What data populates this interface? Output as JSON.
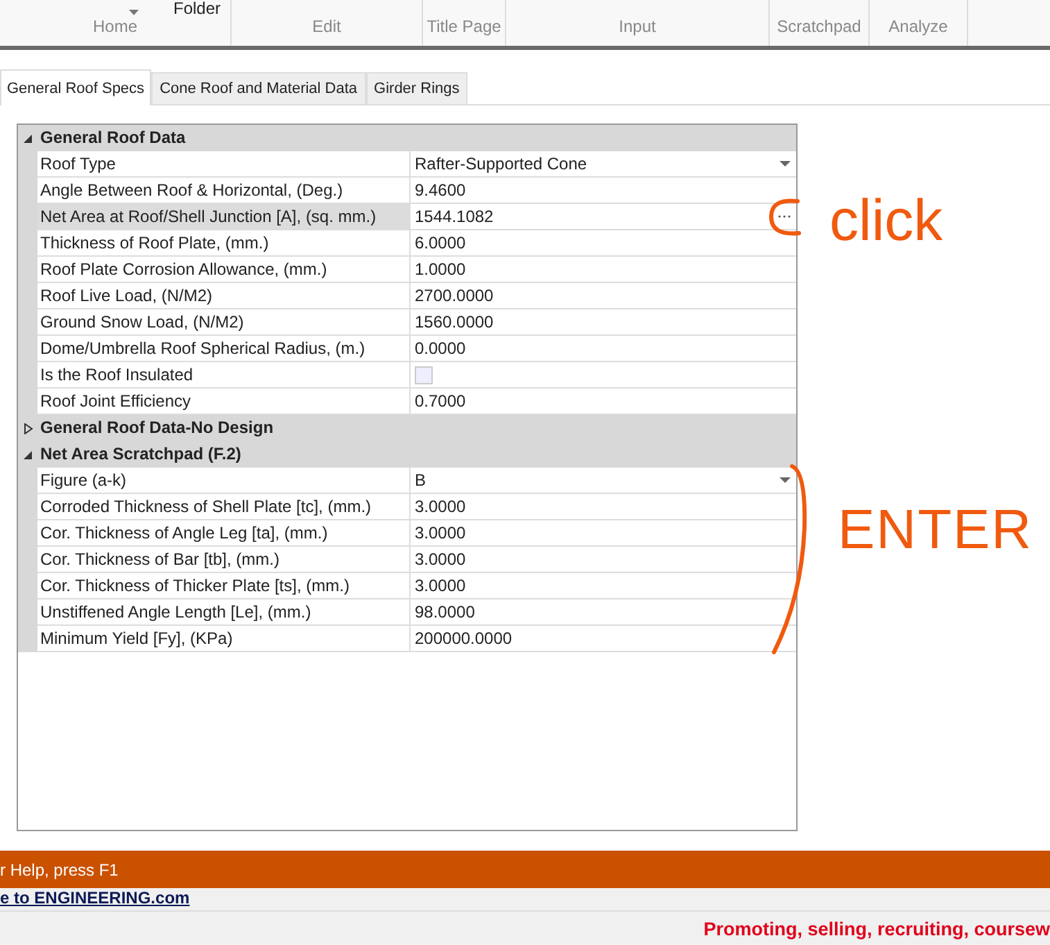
{
  "ribbon": {
    "folder_label": "Folder",
    "groups": [
      {
        "label": "Home"
      },
      {
        "label": "Edit"
      },
      {
        "label": "Title Page"
      },
      {
        "label": "Input"
      },
      {
        "label": "Scratchpad"
      },
      {
        "label": "Analyze"
      }
    ]
  },
  "tabs": [
    {
      "label": "General Roof Specs",
      "selected": true
    },
    {
      "label": "Cone Roof and Material Data",
      "selected": false
    },
    {
      "label": "Girder Rings",
      "selected": false
    }
  ],
  "property_grid": {
    "categories": [
      {
        "title": "General Roof Data",
        "expanded": true,
        "properties": [
          {
            "name": "Roof Type",
            "value": "Rafter-Supported Cone",
            "kind": "dropdown",
            "selected": false
          },
          {
            "name": "Angle Between Roof & Horizontal, (Deg.)",
            "value": "9.4600",
            "kind": "text",
            "selected": false
          },
          {
            "name": "Net Area at Roof/Shell Junction [A], (sq. mm.)",
            "value": "1544.1082",
            "kind": "ellipsis",
            "selected": true
          },
          {
            "name": "Thickness of Roof Plate, (mm.)",
            "value": "6.0000",
            "kind": "text",
            "selected": false
          },
          {
            "name": "Roof Plate Corrosion Allowance, (mm.)",
            "value": "1.0000",
            "kind": "text",
            "selected": false
          },
          {
            "name": "Roof Live Load, (N/M2)",
            "value": "2700.0000",
            "kind": "text",
            "selected": false
          },
          {
            "name": "Ground Snow Load, (N/M2)",
            "value": "1560.0000",
            "kind": "text",
            "selected": false
          },
          {
            "name": "Dome/Umbrella Roof Spherical Radius, (m.)",
            "value": "0.0000",
            "kind": "text",
            "selected": false
          },
          {
            "name": "Is the Roof Insulated",
            "checked": false,
            "kind": "checkbox",
            "selected": false
          },
          {
            "name": "Roof Joint Efficiency",
            "value": "0.7000",
            "kind": "text",
            "selected": false
          }
        ]
      },
      {
        "title": "General Roof Data-No Design",
        "expanded": false
      },
      {
        "title": "Net Area Scratchpad (F.2)",
        "expanded": true,
        "properties": [
          {
            "name": "Figure (a-k)",
            "value": "B",
            "kind": "dropdown",
            "selected": false
          },
          {
            "name": "Corroded Thickness of Shell Plate [tc], (mm.)",
            "value": "3.0000",
            "kind": "text",
            "selected": false
          },
          {
            "name": "Cor. Thickness of Angle Leg [ta], (mm.)",
            "value": "3.0000",
            "kind": "text",
            "selected": false
          },
          {
            "name": "Cor. Thickness of Bar [tb], (mm.)",
            "value": "3.0000",
            "kind": "text",
            "selected": false
          },
          {
            "name": "Cor. Thickness of Thicker Plate [ts], (mm.)",
            "value": "3.0000",
            "kind": "text",
            "selected": false
          },
          {
            "name": "Unstiffened Angle Length [Le], (mm.)",
            "value": "98.0000",
            "kind": "text",
            "selected": false
          },
          {
            "name": "Minimum Yield [Fy], (KPa)",
            "value": "200000.0000",
            "kind": "text",
            "selected": false
          }
        ]
      }
    ]
  },
  "annotations": [
    {
      "text": "click"
    },
    {
      "text": "ENTER"
    }
  ],
  "status_bar": {
    "help": "r Help, press F1",
    "link": "e to ENGINEERING.com",
    "promo": "Promoting, selling, recruiting, coursew"
  }
}
